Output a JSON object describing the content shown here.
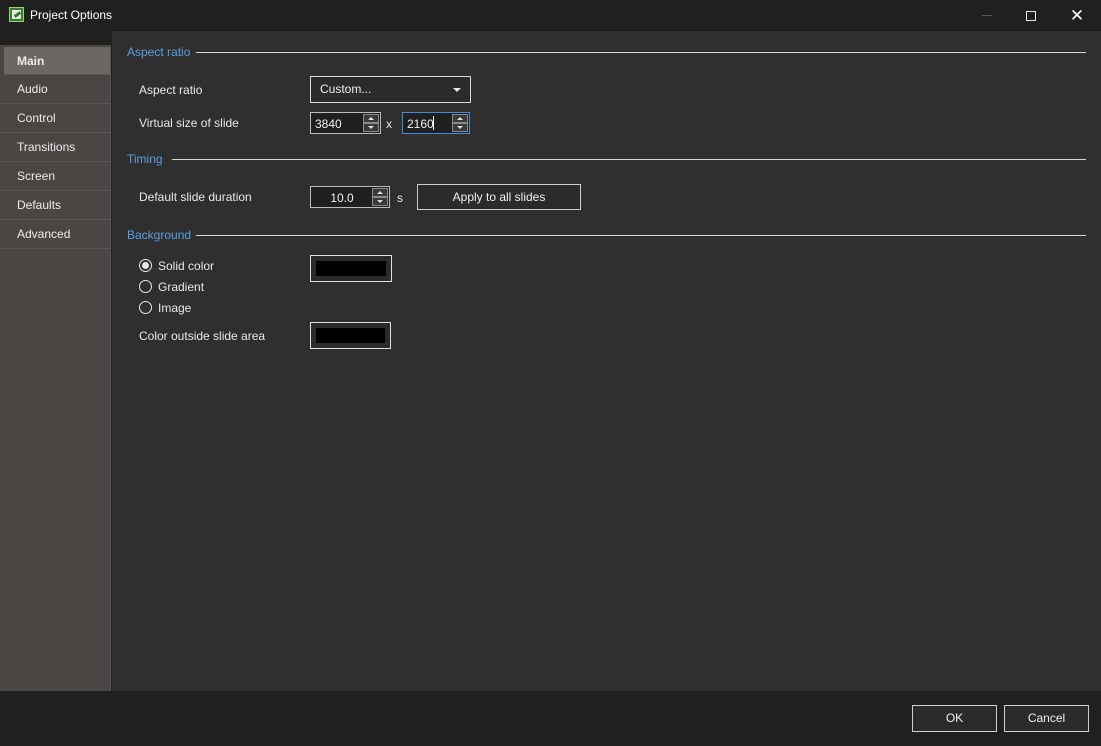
{
  "window": {
    "title": "Project Options"
  },
  "sidebar": {
    "items": [
      {
        "label": "Main",
        "active": true
      },
      {
        "label": "Audio"
      },
      {
        "label": "Control"
      },
      {
        "label": "Transitions"
      },
      {
        "label": "Screen"
      },
      {
        "label": "Defaults"
      },
      {
        "label": "Advanced"
      }
    ]
  },
  "aspect": {
    "section_title": "Aspect ratio",
    "label": "Aspect ratio",
    "dropdown_value": "Custom...",
    "virtual_label": "Virtual size of slide",
    "width": "3840",
    "separator": "x",
    "height": "2160"
  },
  "timing": {
    "section_title": "Timing",
    "label": "Default slide duration",
    "duration": "10.0",
    "unit": "s",
    "apply_button": "Apply to all slides"
  },
  "background": {
    "section_title": "Background",
    "options": [
      {
        "label": "Solid color",
        "checked": true
      },
      {
        "label": "Gradient",
        "checked": false
      },
      {
        "label": "Image",
        "checked": false
      }
    ],
    "solid_color": "#000000",
    "outside_label": "Color outside slide area",
    "outside_color": "#000000"
  },
  "footer": {
    "ok": "OK",
    "cancel": "Cancel"
  },
  "colors": {
    "accent": "#5aa0e0",
    "focus": "#3d8ee0"
  }
}
